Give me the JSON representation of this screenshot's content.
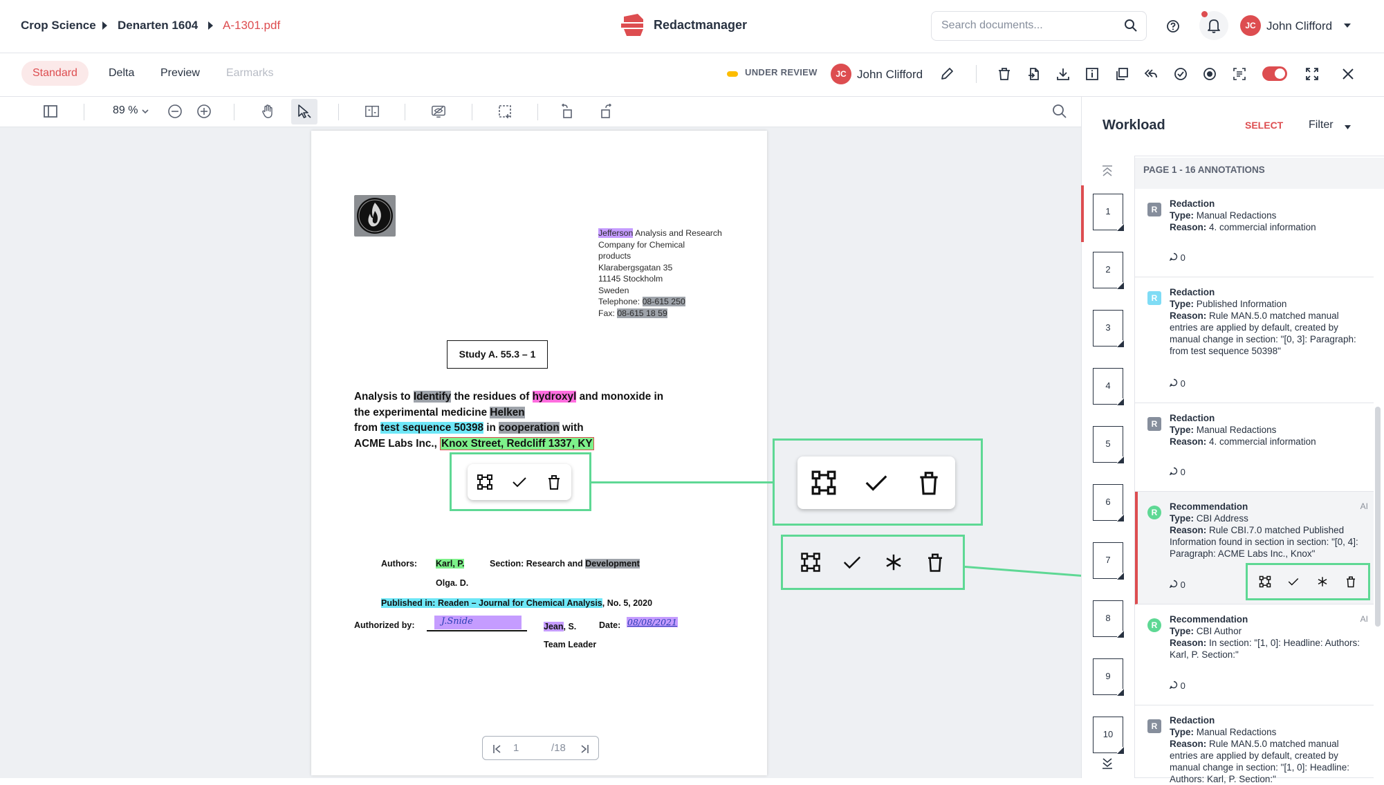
{
  "breadcrumb": [
    "Crop Science",
    "Denarten 1604",
    "A-1301.pdf"
  ],
  "brand": {
    "name": "Redactmanager",
    "accent": "#dd4d50"
  },
  "search": {
    "placeholder": "Search documents..."
  },
  "user": {
    "initials": "JC",
    "name": "John Clifford"
  },
  "tabs": {
    "standard": "Standard",
    "delta": "Delta",
    "preview": "Preview",
    "earmarks": "Earmarks"
  },
  "review": {
    "status": "UNDER REVIEW",
    "assignee": "John Clifford",
    "assignee_initials": "JC"
  },
  "viewer": {
    "zoom": "89 %",
    "current_page": "1",
    "total_pages": "/18"
  },
  "document": {
    "address": {
      "company_name": "Jefferson",
      "line1_rest": " Analysis and Research",
      "line2": "Company for Chemical",
      "line3": "products",
      "line4": "Klarabergsgatan 35",
      "line5": "11145 Stockholm",
      "line6": "Sweden",
      "tel_label": "Telephone: ",
      "tel_value": "08-615 250",
      "fax_label": "Fax: ",
      "fax_value": "08-615 18 59"
    },
    "study": "Study A. 55.3 – 1",
    "title": {
      "p1": "Analysis to ",
      "identify": "Identify",
      "p2": " the residues of ",
      "hydroxyl": "hydroxyl",
      "p3": " and monoxide in",
      "p4": "the experimental medicine ",
      "helken": "Helken",
      "p5": "from ",
      "test_sequence": "test sequence 50398",
      "p6": " in ",
      "cooperation": "cooperation",
      "p7": " with",
      "p8": "ACME Labs Inc., ",
      "address": "Knox Street, Redcliff 1337, KY"
    },
    "authors_label": "Authors:",
    "author1": "Karl, P.",
    "author2": "Olga. D.",
    "section_label": "Section: Research and ",
    "section_value": "Development",
    "published": "Published in: Readen – Journal for Chemical Analysis",
    "published_rest": ", No. 5, 2020",
    "authorized_label": "Authorized by:",
    "signature": "J.Snide",
    "jean": "Jean",
    "jean_rest": ", S.",
    "date_label": "Date:",
    "date_value": "08/08/2021",
    "team_leader": "Team Leader"
  },
  "workload": {
    "title": "Workload",
    "select": "SELECT",
    "filter": "Filter",
    "page_header": "PAGE 1 - 16 ANNOTATIONS",
    "thumbnails": [
      "1",
      "2",
      "3",
      "4",
      "5",
      "6",
      "7",
      "8",
      "9",
      "10"
    ],
    "annotations": [
      {
        "badge": "R",
        "badge_color": "#868e9c",
        "title": "Redaction",
        "type_label": "Type:",
        "type": "Manual Redactions",
        "reason_label": "Reason:",
        "reason": "4. commercial information",
        "comments": "0",
        "ai": ""
      },
      {
        "badge": "R",
        "badge_color": "#7fdcf5",
        "title": "Redaction",
        "type_label": "Type:",
        "type": "Published Information",
        "reason_label": "Reason:",
        "reason": "Rule MAN.5.0 matched manual entries are applied by default, created by manual change in section: \"[0, 3]: Paragraph: from test sequence 50398\"",
        "comments": "0",
        "ai": ""
      },
      {
        "badge": "R",
        "badge_color": "#868e9c",
        "title": "Redaction",
        "type_label": "Type:",
        "type": "Manual Redactions",
        "reason_label": "Reason:",
        "reason": "4. commercial information",
        "comments": "0",
        "ai": ""
      },
      {
        "badge": "R",
        "badge_color": "#5ed894",
        "title": "Recommendation",
        "type_label": "Type:",
        "type": "CBI Address",
        "reason_label": "Reason:",
        "reason": "Rule CBI.7.0 matched Published Information found in section in section: \"[0, 4]: Paragraph: ACME Labs Inc., Knox\"",
        "comments": "0",
        "ai": "AI"
      },
      {
        "badge": "R",
        "badge_color": "#5ed894",
        "title": "Recommendation",
        "type_label": "Type:",
        "type": "CBI Author",
        "reason_label": "Reason:",
        "reason": "In section: \"[1, 0]: Headline: Authors: Karl, P. Section:\"",
        "comments": "0",
        "ai": "AI"
      },
      {
        "badge": "R",
        "badge_color": "#868e9c",
        "title": "Redaction",
        "type_label": "Type:",
        "type": "Manual Redactions",
        "reason_label": "Reason:",
        "reason": "Rule MAN.5.0 matched manual entries are applied by default, created by manual change in section: \"[1, 0]: Headline: Authors: Karl, P. Section:\"",
        "comments": "",
        "ai": ""
      }
    ]
  }
}
